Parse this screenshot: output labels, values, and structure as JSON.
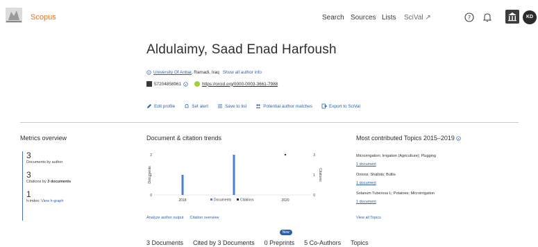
{
  "header": {
    "brand": "Scopus",
    "nav": [
      "Search",
      "Sources",
      "Lists"
    ],
    "scival_label": "SciVal ↗",
    "avatar_initials": "KD"
  },
  "profile": {
    "name": "Aldulaimy, Saad Enad Harfoush",
    "affiliation_name": "University Of Anbar",
    "affiliation_location": ", Ramadi, Iraq",
    "show_all_author_info": "Show all author info",
    "author_id": "57204858961",
    "orcid_url": "https://orcid.org/0000-0003-3661-7988",
    "actions": [
      "Edit profile",
      "Set alert",
      "Save to list",
      "Potential author matches",
      "Export to SciVal"
    ]
  },
  "metrics": {
    "title": "Metrics overview",
    "documents_value": "3",
    "documents_label": "Documents by author",
    "citations_value": "3",
    "citations_label_prefix": "Citations by ",
    "citations_label_bold": "3 documents",
    "hindex_value": "1",
    "hindex_label": "h-index:",
    "hindex_link": "View h-graph"
  },
  "trends": {
    "title": "Document & citation trends",
    "analyze_link": "Analyze author output",
    "citation_link": "Citation overview"
  },
  "chart_data": {
    "type": "bar",
    "x": [
      2018,
      2019
    ],
    "x_ticks": [
      "2018",
      "2020"
    ],
    "series": [
      {
        "name": "Documents",
        "axis": "left",
        "type": "bar",
        "x": [
          2018,
          2019
        ],
        "values": [
          1,
          2
        ],
        "color": "#4a7fd6"
      },
      {
        "name": "Citations",
        "axis": "right",
        "type": "point",
        "x": [
          2020
        ],
        "values": [
          3
        ],
        "color": "#1a2a5a"
      }
    ],
    "ylabel": "Documents",
    "y2label": "Citations",
    "ylim": [
      0,
      2
    ],
    "y2lim": [
      0,
      3
    ],
    "y_ticks": [
      "0",
      "1",
      "2"
    ],
    "y2_ticks": [
      "0",
      "1",
      "3"
    ],
    "legend_position": "bottom"
  },
  "topics": {
    "title": "Most contributed Topics 2015–2019",
    "items": [
      {
        "name": "Microirrigation; Irrigation (Agriculture); Plugging",
        "docs": "1 document"
      },
      {
        "name": "Onions; Shallots; Bulbs",
        "docs": "1 document"
      },
      {
        "name": "Solanum Tuberosa L; Potatoes; Microirrigation",
        "docs": "1 document"
      }
    ],
    "view_all": "View all Topics"
  },
  "tabs": {
    "items": [
      "3 Documents",
      "Cited by 3 Documents",
      "0 Preprints",
      "5 Co-Authors",
      "Topics"
    ],
    "new_badge": "New"
  },
  "colors": {
    "brand": "#e9711c",
    "link": "#2e5fa8",
    "bar": "#4a7fd6"
  }
}
